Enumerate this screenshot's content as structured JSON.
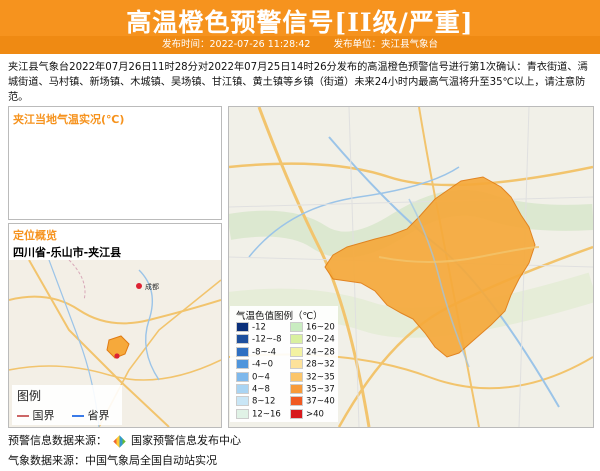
{
  "header": {
    "title": "高温橙色预警信号[II级/严重]",
    "publish_time": "发布时间：2022-07-26 11:28:42",
    "publisher": "发布单位：夹江县气象台"
  },
  "notice": "夹江县气象台2022年07月26日11时28分对2022年07月25日14时26分发布的高温橙色预警信号进行第1次确认：青衣街道、漹城街道、马村镇、新场镇、木城镇、吴场镇、甘江镇、黄土镇等乡镇（街道）未来24小时内最高气温将升至35℃以上，请注意防范。",
  "temp_panel": {
    "title": "夹江当地气温实况(℃)"
  },
  "location_panel": {
    "title": "定位概览",
    "location": "四川省-乐山市-夹江县"
  },
  "small_legend": {
    "title": "图例",
    "national_border": "国界",
    "province_border": "省界"
  },
  "map_labels": {
    "chengdu": "成都"
  },
  "temp_legend": {
    "title": "气温色值图例（℃）",
    "items": [
      {
        "label": "-12",
        "color": "#0a2f7a"
      },
      {
        "label": "16~20",
        "color": "#c9ecc1"
      },
      {
        "label": "-12~-8",
        "color": "#1d4f9e"
      },
      {
        "label": "20~24",
        "color": "#d9f0a0"
      },
      {
        "label": "-8~-4",
        "color": "#2e6fc2"
      },
      {
        "label": "24~28",
        "color": "#f3f2a2"
      },
      {
        "label": "-4~0",
        "color": "#4f95dc"
      },
      {
        "label": "28~32",
        "color": "#fde29a"
      },
      {
        "label": "0~4",
        "color": "#7eb8ec"
      },
      {
        "label": "32~35",
        "color": "#fbc56a"
      },
      {
        "label": "4~8",
        "color": "#a9d4f3"
      },
      {
        "label": "35~37",
        "color": "#f79b3a"
      },
      {
        "label": "8~12",
        "color": "#c9e6f6"
      },
      {
        "label": "37~40",
        "color": "#f05a22"
      },
      {
        "label": "12~16",
        "color": "#e0f2e6"
      },
      {
        "label": ">40",
        "color": "#d7191c"
      }
    ]
  },
  "footer": {
    "warning_source": "预警信息数据来源：",
    "warning_source_name": "国家预警信息发布中心",
    "weather_source": "气象数据来源：中国气象局全国自动站实况"
  },
  "colors": {
    "accent": "#f6931e",
    "region_fill": "#f6a93b"
  }
}
